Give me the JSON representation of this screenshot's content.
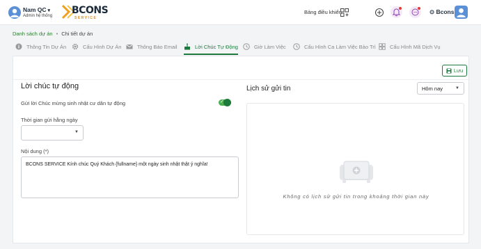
{
  "user": {
    "name": "Nam QC",
    "role": "Admin hệ thống"
  },
  "logo": {
    "text": "BCONS",
    "sub": "SERVICE"
  },
  "header": {
    "dashboard_label": "Bảng điều khiển",
    "org_name": "Bcons"
  },
  "breadcrumb": {
    "parent": "Danh sách dự án",
    "separator": "•",
    "current": "Chi tiết dự án"
  },
  "tabs": [
    {
      "label": "Thông Tin Dự Án",
      "icon": "info-icon"
    },
    {
      "label": "Cấu Hình Dự Án",
      "icon": "gear-icon"
    },
    {
      "label": "Thông Báo Email",
      "icon": "mail-icon"
    },
    {
      "label": "Lời Chúc Tự Động",
      "icon": "cake-icon",
      "active": true
    },
    {
      "label": "Giờ Làm Việc",
      "icon": "clock-icon"
    },
    {
      "label": "Cấu Hình Ca Làm Việc Bảo Trì",
      "icon": "clock-icon"
    },
    {
      "label": "Cấu Hình Mã Dịch Vụ",
      "icon": "grid-icon"
    }
  ],
  "actions": {
    "save_label": "Lưu"
  },
  "form": {
    "title": "Lời chúc tự động",
    "toggle_label": "Gửi lời Chúc mừng sinh nhật cư dân tự động",
    "toggle_on": true,
    "time_label": "Thời gian gửi hằng ngày",
    "time_value": "",
    "content_label": "Nội dung (*)",
    "content_value": "BCONS SERVICE Kính chúc Quý Khách {fullname} một ngày sinh nhật thật ý nghĩa!"
  },
  "history": {
    "title": "Lịch sử gửi tin",
    "range_value": "Hôm nay",
    "empty_text": "Không có lịch sử gửi tin trong khoảng thời gian này"
  },
  "colors": {
    "accent": "#1b7a3c",
    "avatar": "#5b8fd6",
    "notification_dot": "#e53935"
  }
}
